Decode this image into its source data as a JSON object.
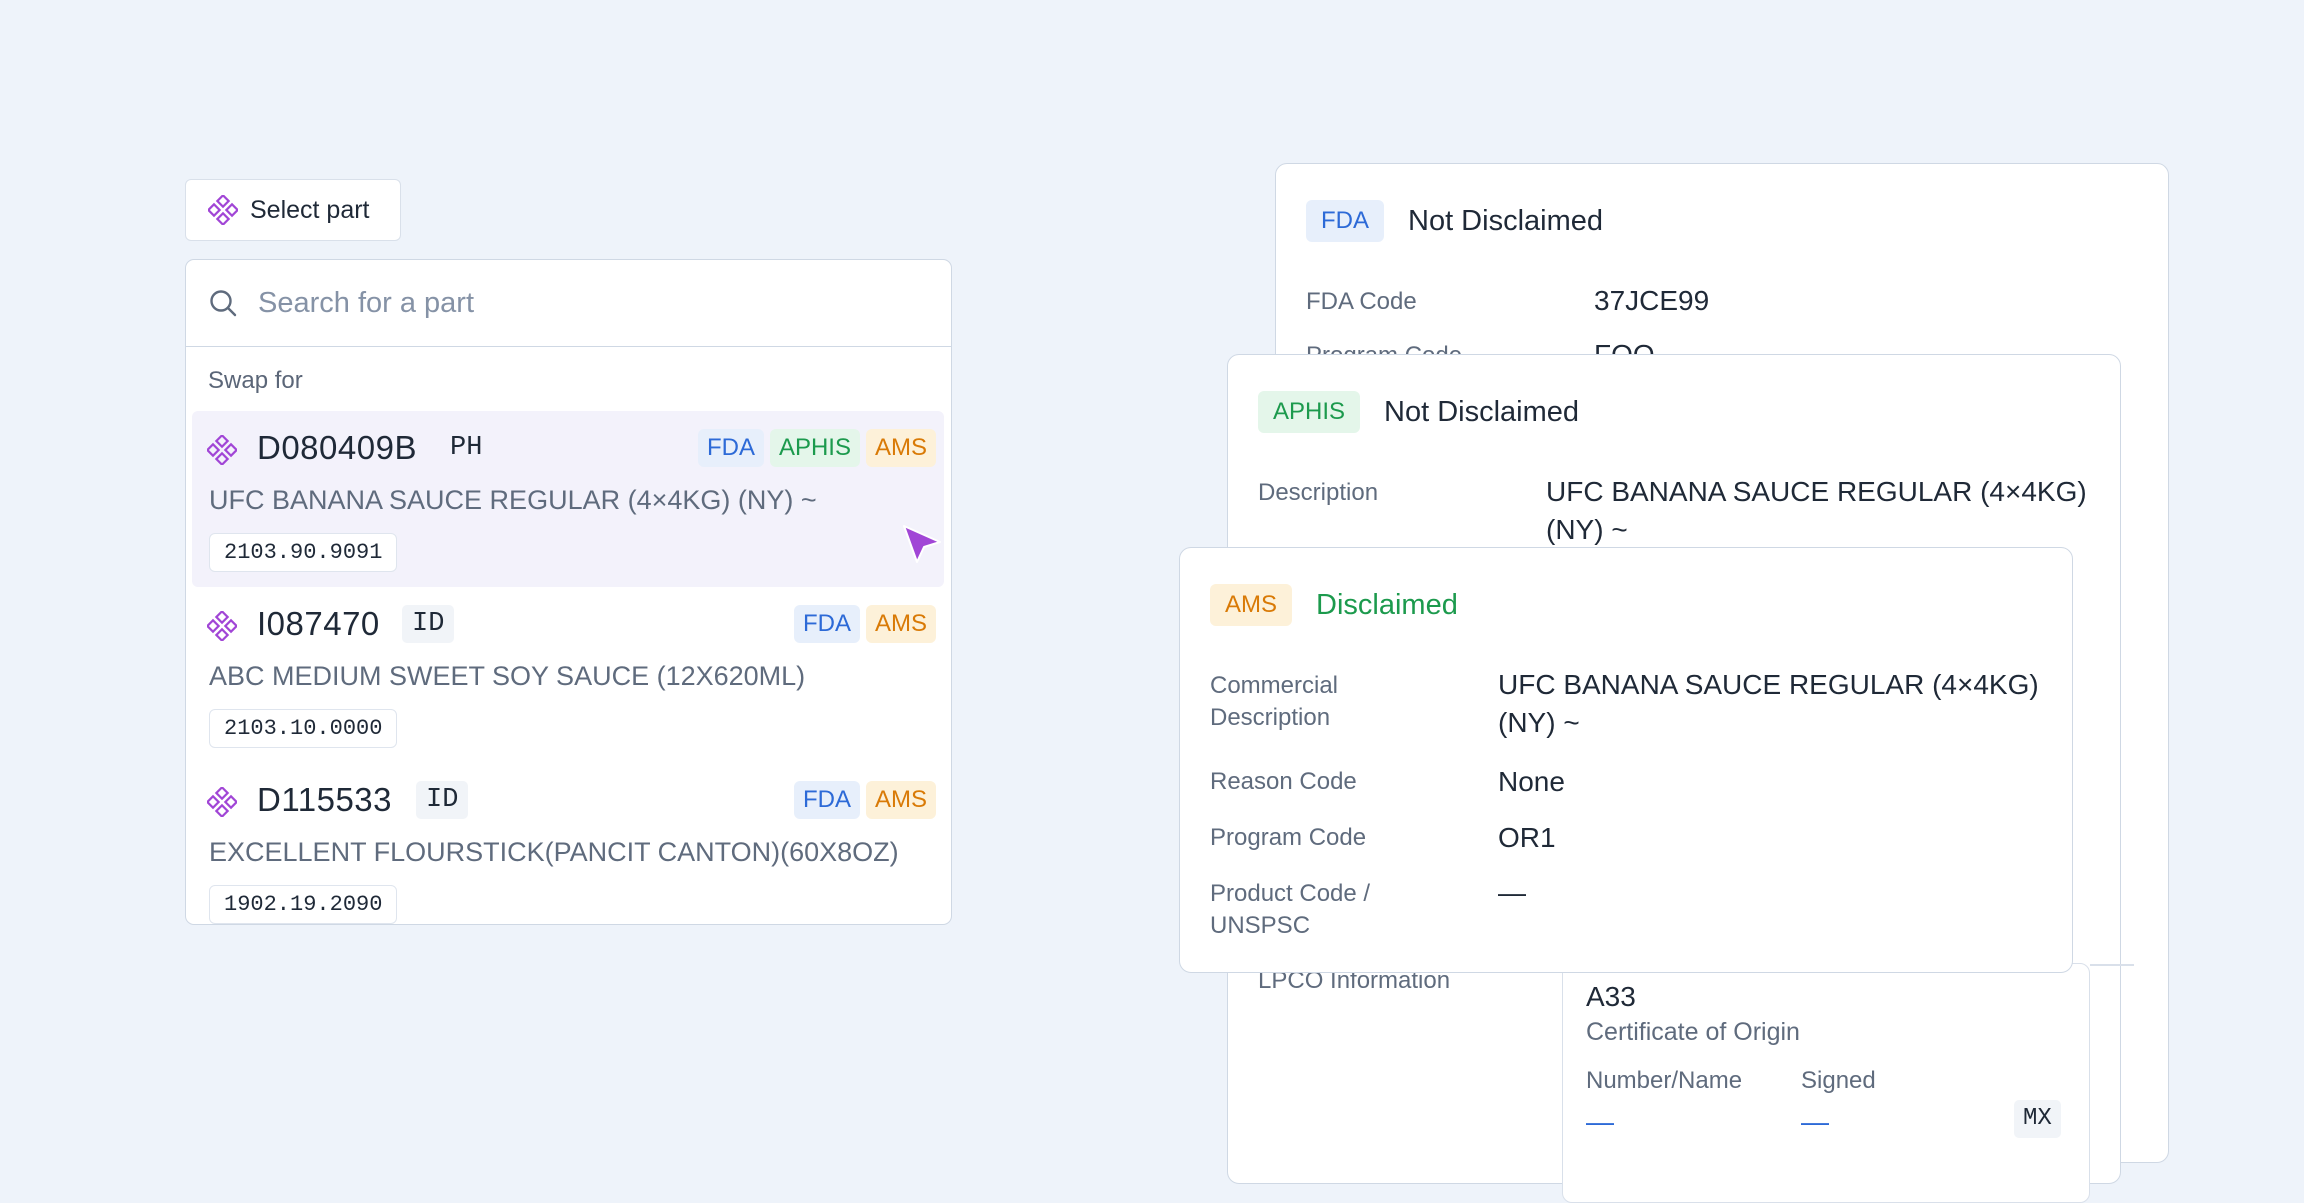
{
  "select_button": {
    "label": "Select part",
    "icon": "component-diamond-icon"
  },
  "picker": {
    "search_placeholder": "Search for a part",
    "section_label": "Swap for",
    "parts": [
      {
        "code": "D080409B",
        "origin": "PH",
        "tags": [
          "FDA",
          "APHIS",
          "AMS"
        ],
        "description": "UFC BANANA SAUCE REGULAR (4×4KG) (NY) ~",
        "hts": "2103.90.9091",
        "active": true
      },
      {
        "code": "I087470",
        "origin": "ID",
        "tags": [
          "FDA",
          "AMS"
        ],
        "description": "ABC MEDIUM SWEET SOY SAUCE (12X620ML)",
        "hts": "2103.10.0000"
      },
      {
        "code": "D115533",
        "origin": "ID",
        "tags": [
          "FDA",
          "AMS"
        ],
        "description": "EXCELLENT FLOURSTICK(PANCIT CANTON)(60X8OZ)",
        "hts": "1902.19.2090"
      }
    ]
  },
  "cards": {
    "fda": {
      "tag": "FDA",
      "status": "Not Disclaimed",
      "rows": [
        {
          "label": "FDA Code",
          "value": "37JCE99"
        },
        {
          "label": "Program Code",
          "value": "FOO"
        }
      ]
    },
    "aphis": {
      "tag": "APHIS",
      "status": "Not Disclaimed",
      "description_label": "Description",
      "description_value": "UFC BANANA SAUCE REGULAR (4×4KG) (NY) ~",
      "lpco_label": "LPCO Information",
      "lpco": {
        "code": "A33",
        "type": "Certificate of Origin",
        "number_label": "Number/Name",
        "number_value": "—",
        "signed_label": "Signed",
        "signed_value": "—",
        "country": "MX"
      }
    },
    "ams": {
      "tag": "AMS",
      "status": "Disclaimed",
      "rows": [
        {
          "label": "Commercial Description",
          "value": "UFC BANANA SAUCE REGULAR (4×4KG) (NY) ~"
        },
        {
          "label": "Reason Code",
          "value": "None"
        },
        {
          "label": "Program Code",
          "value": "OR1"
        },
        {
          "label": "Product Code / UNSPSC",
          "value": "—"
        }
      ]
    }
  },
  "colors": {
    "fda": "#2d6ad7",
    "aphis": "#1c9a4d",
    "ams": "#d97a06",
    "accent_purple": "#a146d6"
  }
}
